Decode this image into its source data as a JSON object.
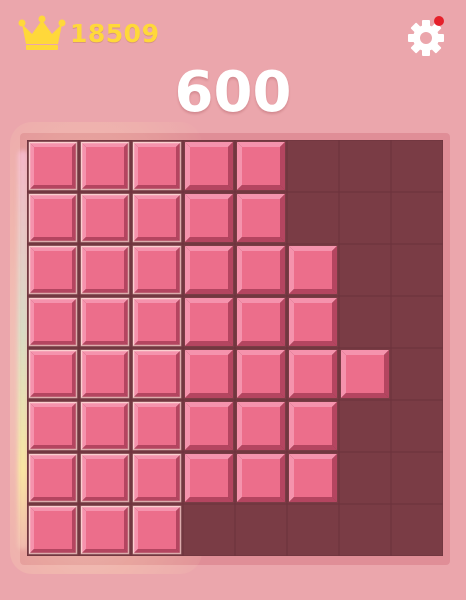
{
  "header": {
    "best_score": "18509",
    "crown_icon": "crown-icon",
    "settings_icon": "gear-icon",
    "settings_has_notification": true
  },
  "score": {
    "value": "600"
  },
  "board": {
    "rows": 8,
    "cols": 8,
    "colors": {
      "empty_cell": "#7a3c45",
      "block_fill": "#ec6e8b",
      "block_highlight": "#f593ad",
      "block_shadow": "#b44560",
      "frame": "#e08e97",
      "background": "#eba6ac",
      "accent_gold": "#ffd83a"
    },
    "filled_cells": [
      [
        0,
        0
      ],
      [
        0,
        1
      ],
      [
        0,
        2
      ],
      [
        0,
        3
      ],
      [
        0,
        4
      ],
      [
        1,
        0
      ],
      [
        1,
        1
      ],
      [
        1,
        2
      ],
      [
        1,
        3
      ],
      [
        1,
        4
      ],
      [
        2,
        0
      ],
      [
        2,
        1
      ],
      [
        2,
        2
      ],
      [
        2,
        3
      ],
      [
        2,
        4
      ],
      [
        2,
        5
      ],
      [
        3,
        0
      ],
      [
        3,
        1
      ],
      [
        3,
        2
      ],
      [
        3,
        3
      ],
      [
        3,
        4
      ],
      [
        3,
        5
      ],
      [
        4,
        0
      ],
      [
        4,
        1
      ],
      [
        4,
        2
      ],
      [
        4,
        3
      ],
      [
        4,
        4
      ],
      [
        4,
        5
      ],
      [
        4,
        6
      ],
      [
        5,
        0
      ],
      [
        5,
        1
      ],
      [
        5,
        2
      ],
      [
        5,
        3
      ],
      [
        5,
        4
      ],
      [
        5,
        5
      ],
      [
        6,
        0
      ],
      [
        6,
        1
      ],
      [
        6,
        2
      ],
      [
        6,
        3
      ],
      [
        6,
        4
      ],
      [
        6,
        5
      ],
      [
        7,
        0
      ],
      [
        7,
        1
      ],
      [
        7,
        2
      ]
    ],
    "highlighted_columns": [
      0,
      1,
      2
    ]
  }
}
